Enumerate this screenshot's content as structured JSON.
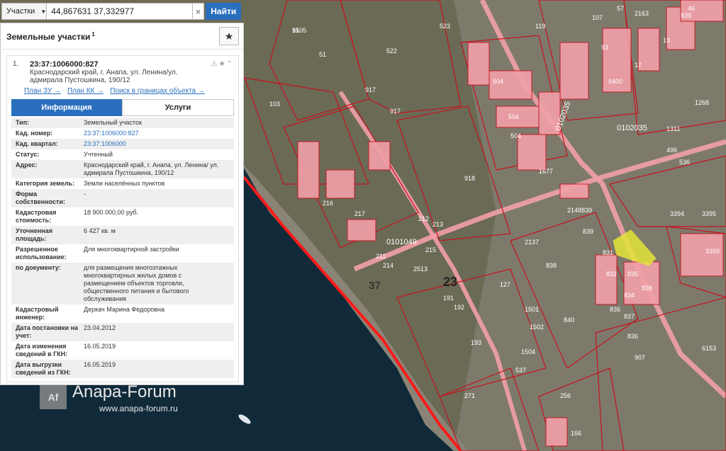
{
  "search": {
    "layer_label": "Участки",
    "query": "44,867631 37,332977",
    "button_label": "Найти",
    "clear_symbol": "×"
  },
  "panel": {
    "title": "Земельные участки",
    "count": "1",
    "result": {
      "index": "1.",
      "cadastral_id": "23:37:1006000:827",
      "address_line1": "Краснодарский край, г. Анапа, ул. Ленина/ул.",
      "address_line2": "адмирала Пустошкина, 190/12",
      "links": {
        "plan_zu": "План ЗУ →",
        "plan_kk": "План КК →",
        "search_within": "Поиск в границах объекта →"
      },
      "tabs": {
        "info": "Информация",
        "services": "Услуги"
      },
      "rows": [
        {
          "label": "Тип:",
          "value": "Земельный участок"
        },
        {
          "label": "Кад. номер:",
          "value": "23:37:1006000:827"
        },
        {
          "label": "Кад. квартал:",
          "value": "23:37:1006000"
        },
        {
          "label": "Статус:",
          "value": "Учтенный"
        },
        {
          "label": "Адрес:",
          "value": "Краснодарский край, г. Анапа, ул. Ленина/ ул. адмирала Пустошкина, 190/12"
        },
        {
          "label": "Категория земель:",
          "value": "Земли населённых пунктов"
        },
        {
          "label": "Форма собственности:",
          "value": "-"
        },
        {
          "label": "Кадастровая стоимость:",
          "value": "18 900 000,00 руб."
        },
        {
          "label": "Уточненная площадь:",
          "value": "6 427 кв. м"
        },
        {
          "label": "Разрешенное использование:",
          "value": "Для многоквартирной застройки"
        },
        {
          "label": "по документу:",
          "value": "для размещения многоэтажных многоквартирных жилых домов с размещением объектов торговли, общественного питания и бытового обслуживания"
        },
        {
          "label": "Кадастровый инженер:",
          "value": "Деркач Марина Федоровна"
        },
        {
          "label": "Дата постановки на учет:",
          "value": "23.04.2012"
        },
        {
          "label": "Дата изменения сведений в ГКН:",
          "value": "16.05.2019"
        },
        {
          "label": "Дата выгрузки сведений из ГКН:",
          "value": "16.05.2019"
        }
      ]
    }
  },
  "map": {
    "district_label": "23",
    "zone_label": "37",
    "quarter_labels": [
      "0101049",
      "0102035",
      "0102035"
    ],
    "parcel_numbers": [
      "91",
      "51",
      "522",
      "523",
      "917",
      "917",
      "103",
      "918",
      "504",
      "504",
      "504",
      "1677",
      "536",
      "3394",
      "3395",
      "3393",
      "496",
      "839",
      "839",
      "838",
      "840",
      "907",
      "836",
      "6153",
      "537",
      "193",
      "192",
      "191",
      "2513",
      "211",
      "212",
      "213",
      "214",
      "215",
      "216",
      "217",
      "2137",
      "2148",
      "2163",
      "119",
      "1268",
      "1311",
      "271",
      "256",
      "166",
      "831",
      "832",
      "834",
      "835",
      "836",
      "837",
      "838",
      "839",
      "17",
      "19",
      "46",
      "57",
      "93",
      "9400",
      "107",
      "127",
      "1502",
      "1501",
      "1504",
      "1505"
    ],
    "highlight_color": "#e4e43a",
    "parcel_fill": "#f2a0a8",
    "border_color": "#c8121e"
  },
  "watermark": {
    "logo": "Af",
    "title": "Anapa-Forum",
    "url": "www.anapa-forum.ru"
  }
}
